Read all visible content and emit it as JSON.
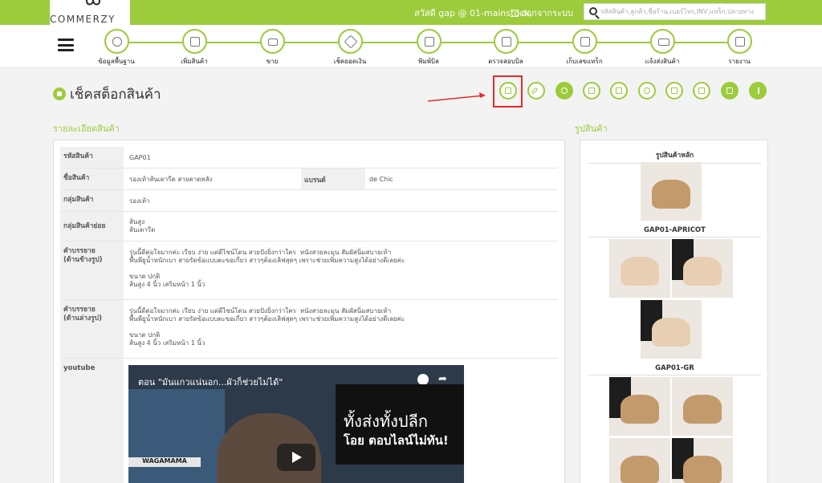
{
  "brand": {
    "name": "COMMERZY"
  },
  "header": {
    "greeting": "สวัสดี gap @ 01-mainstock,",
    "logout_label": "ออกจากระบบ",
    "search_placeholder": "รหัสสินค้า,ลูกค้า,ชื่อร้าน,เบอร์โทร,INV,แทร็ก,ปลายทาง"
  },
  "nav": {
    "items": [
      {
        "label": "ข้อมูลพื้นฐาน",
        "icon": "database-icon"
      },
      {
        "label": "เพิ่มสินค้า",
        "icon": "box-icon"
      },
      {
        "label": "ขาย",
        "icon": "register-icon"
      },
      {
        "label": "เช็คยอดเงิน",
        "icon": "money-check-icon"
      },
      {
        "label": "พิมพ์บิล",
        "icon": "printer-icon"
      },
      {
        "label": "ตรวจสอบบิล",
        "icon": "bill-check-icon"
      },
      {
        "label": "เก็บเลขแทร็ก",
        "icon": "tracking-icon"
      },
      {
        "label": "แจ้งส่งสินค้า",
        "icon": "truck-icon"
      },
      {
        "label": "รายงาน",
        "icon": "report-icon"
      }
    ]
  },
  "page": {
    "title": "เช็คสต็อกสินค้า"
  },
  "toolbar": {
    "icons": [
      "document-icon",
      "pencil-icon",
      "camera-icon",
      "barcode-icon",
      "add-image-icon",
      "undo-icon",
      "layout-icon",
      "list-icon",
      "facebook-icon",
      "arrow-up-icon"
    ]
  },
  "sections": {
    "detail_heading": "รายละเอียดสินค้า",
    "image_heading": "รูปสินค้า"
  },
  "detail": {
    "code_label": "รหัสสินค้า",
    "code_value": "GAP01",
    "name_label": "ชื่อสินค้า",
    "name_value": "รองเท้าส้นเตารีด สายคาดหลัง",
    "brand_label": "แบรนด์",
    "brand_value": "de Chic",
    "group_label": "กลุ่มสินค้า",
    "group_value": "รองเท้า",
    "subgroup_label": "กลุ่มสินค้าย่อย",
    "subgroup_value": "ส้นสูง\nส้นเตารีด",
    "desc_side_label": "คำบรรยาย\n(ด้านข้างรูป)",
    "desc_side_value": "รุ่นนี้ดีต่อใจมากค่ะ เรียบ ง่าย แต่ดีไซน์โดน สวยปังยิ่งกว่าใคร  หนังสวยละมุน สัมผัสนิ่มสบายเท้า\nพื้นพียูน้ำหนักเบา สายรัดข้อแบบตะขอเกี่ยว สาวๆต้องเลิฟสุดๆ เพราะช่วยเพิ่มความสูงได้อย่างดีเลยค่ะ\n\nขนาด ปกติ\nส้นสูง 4 นิ้ว เสริมหน้า 1 นิ้ว",
    "desc_bottom_label": "คำบรรยาย\n(ด้านล่างรูป)",
    "desc_bottom_value": "รุ่นนี้ดีต่อใจมากค่ะ เรียบ ง่าย แต่ดีไซน์โดน สวยปังยิ่งกว่าใคร  หนังสวยละมุน สัมผัสนิ่มสบายเท้า\nพื้นพียูน้ำหนักเบา สายรัดข้อแบบตะขอเกี่ยว สาวๆต้องเลิฟสุดๆ เพราะช่วยเพิ่มความสูงได้อย่างดีเลยค่ะ\n\nขนาด ปกติ\nส้นสูง 4 นิ้ว เสริมหน้า 1 นิ้ว",
    "youtube_label": "youtube"
  },
  "video": {
    "title": "ตอน \"มันแกวแน่นอก...ผัวก็ช่วยไม่ได้\"",
    "big_text": "ทั้งส่งทั้งปลีก",
    "small_text": "โอย ตอบไลน์ไม่ทัน!",
    "sign_text": "WAGAMAMA"
  },
  "images": {
    "main_caption": "รูปสินค้าหลัก",
    "variant1_caption": "GAP01-APRICOT",
    "variant2_caption": "GAP01-GR"
  },
  "colors": {
    "accent": "#9ccb3b",
    "highlight": "#e8292b"
  }
}
